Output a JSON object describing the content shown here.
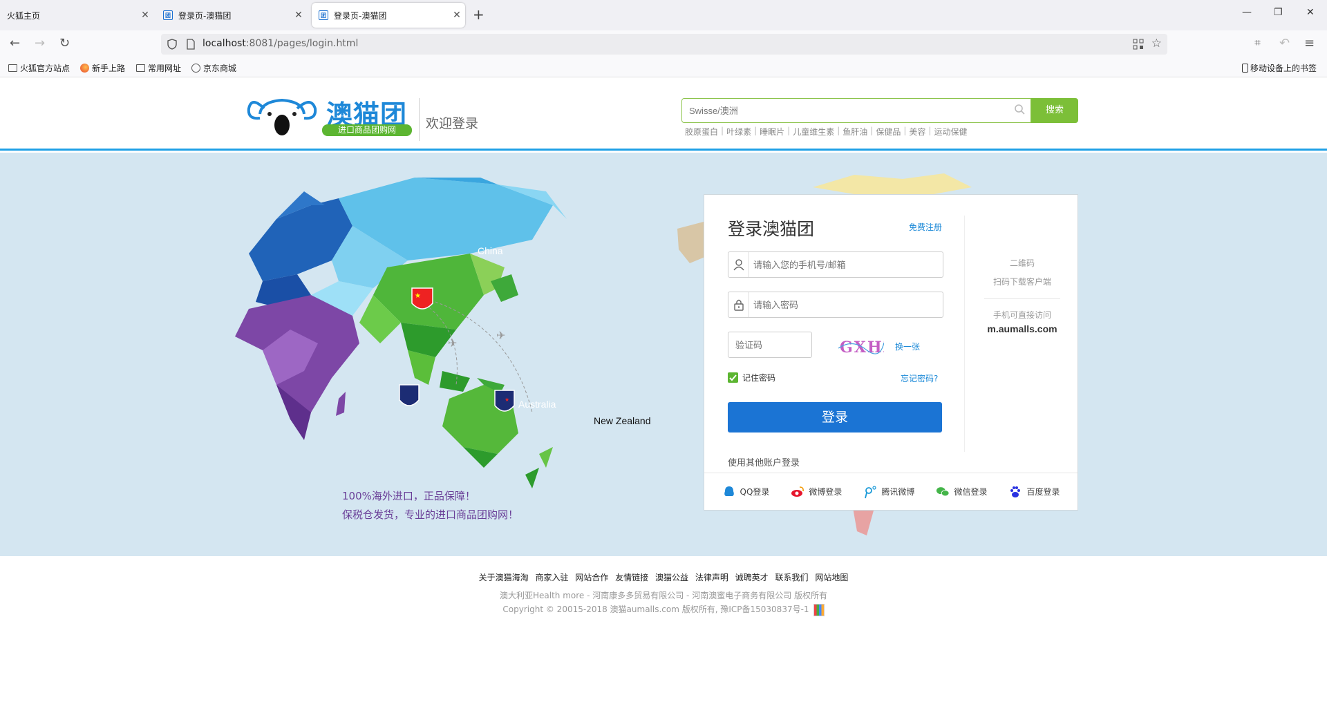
{
  "browser": {
    "tabs": [
      {
        "label": "火狐主页",
        "active": false
      },
      {
        "label": "登录页-澳猫团",
        "active": false
      },
      {
        "label": "登录页-澳猫团",
        "active": true
      }
    ],
    "url_host": "localhost",
    "url_path": ":8081/pages/login.html",
    "bookmarks": [
      "火狐官方站点",
      "新手上路",
      "常用网址",
      "京东商城"
    ],
    "mobile_bookmarks": "移动设备上的书签"
  },
  "header": {
    "logo_text": "澳猫团",
    "logo_sub": "进口商品团购网",
    "welcome": "欢迎登录",
    "search_placeholder": "Swisse/澳洲",
    "search_button": "搜索",
    "hot_words": [
      "胶原蛋白",
      "叶绿素",
      "睡眠片",
      "儿童维生素",
      "鱼肝油",
      "保健品",
      "美容",
      "运动保健"
    ]
  },
  "map": {
    "labels": {
      "china": "China",
      "australia": "Australia",
      "new_zealand": "New Zealand"
    },
    "slogan_line1": "100%海外进口，正品保障！",
    "slogan_line2": "保税仓发货，专业的进口商品团购网！"
  },
  "login": {
    "title": "登录澳猫团",
    "register": "免费注册",
    "account_placeholder": "请输入您的手机号/邮箱",
    "password_placeholder": "请输入密码",
    "captcha_placeholder": "验证码",
    "captcha_text": "GXHZ",
    "refresh_captcha": "换一张",
    "remember": "记住密码",
    "forgot": "忘记密码?",
    "submit": "登录",
    "other_accounts": "使用其他账户登录",
    "social": [
      "QQ登录",
      "微博登录",
      "腾讯微博",
      "微信登录",
      "百度登录"
    ],
    "qr_label": "二维码",
    "qr_sub": "扫码下载客户端",
    "mobile_text": "手机可直接访问",
    "mobile_url": "m.aumalls.com"
  },
  "footer": {
    "links": [
      "关于澳猫海淘",
      "商家入驻",
      "网站合作",
      "友情链接",
      "澳猫公益",
      "法律声明",
      "诚聘英才",
      "联系我们",
      "网站地图"
    ],
    "line1": "澳大利亚Health more - 河南康多多贸易有限公司 - 河南澳蜜电子商务有限公司 版权所有",
    "line2": "Copyright © 20015-2018 澳猫aumalls.com 版权所有, 豫ICP备15030837号-1"
  },
  "colors": {
    "brand_blue": "#1e88d8",
    "brand_green": "#5cb531",
    "login_blue": "#1b74d4",
    "page_bg": "#d4e6f1"
  }
}
